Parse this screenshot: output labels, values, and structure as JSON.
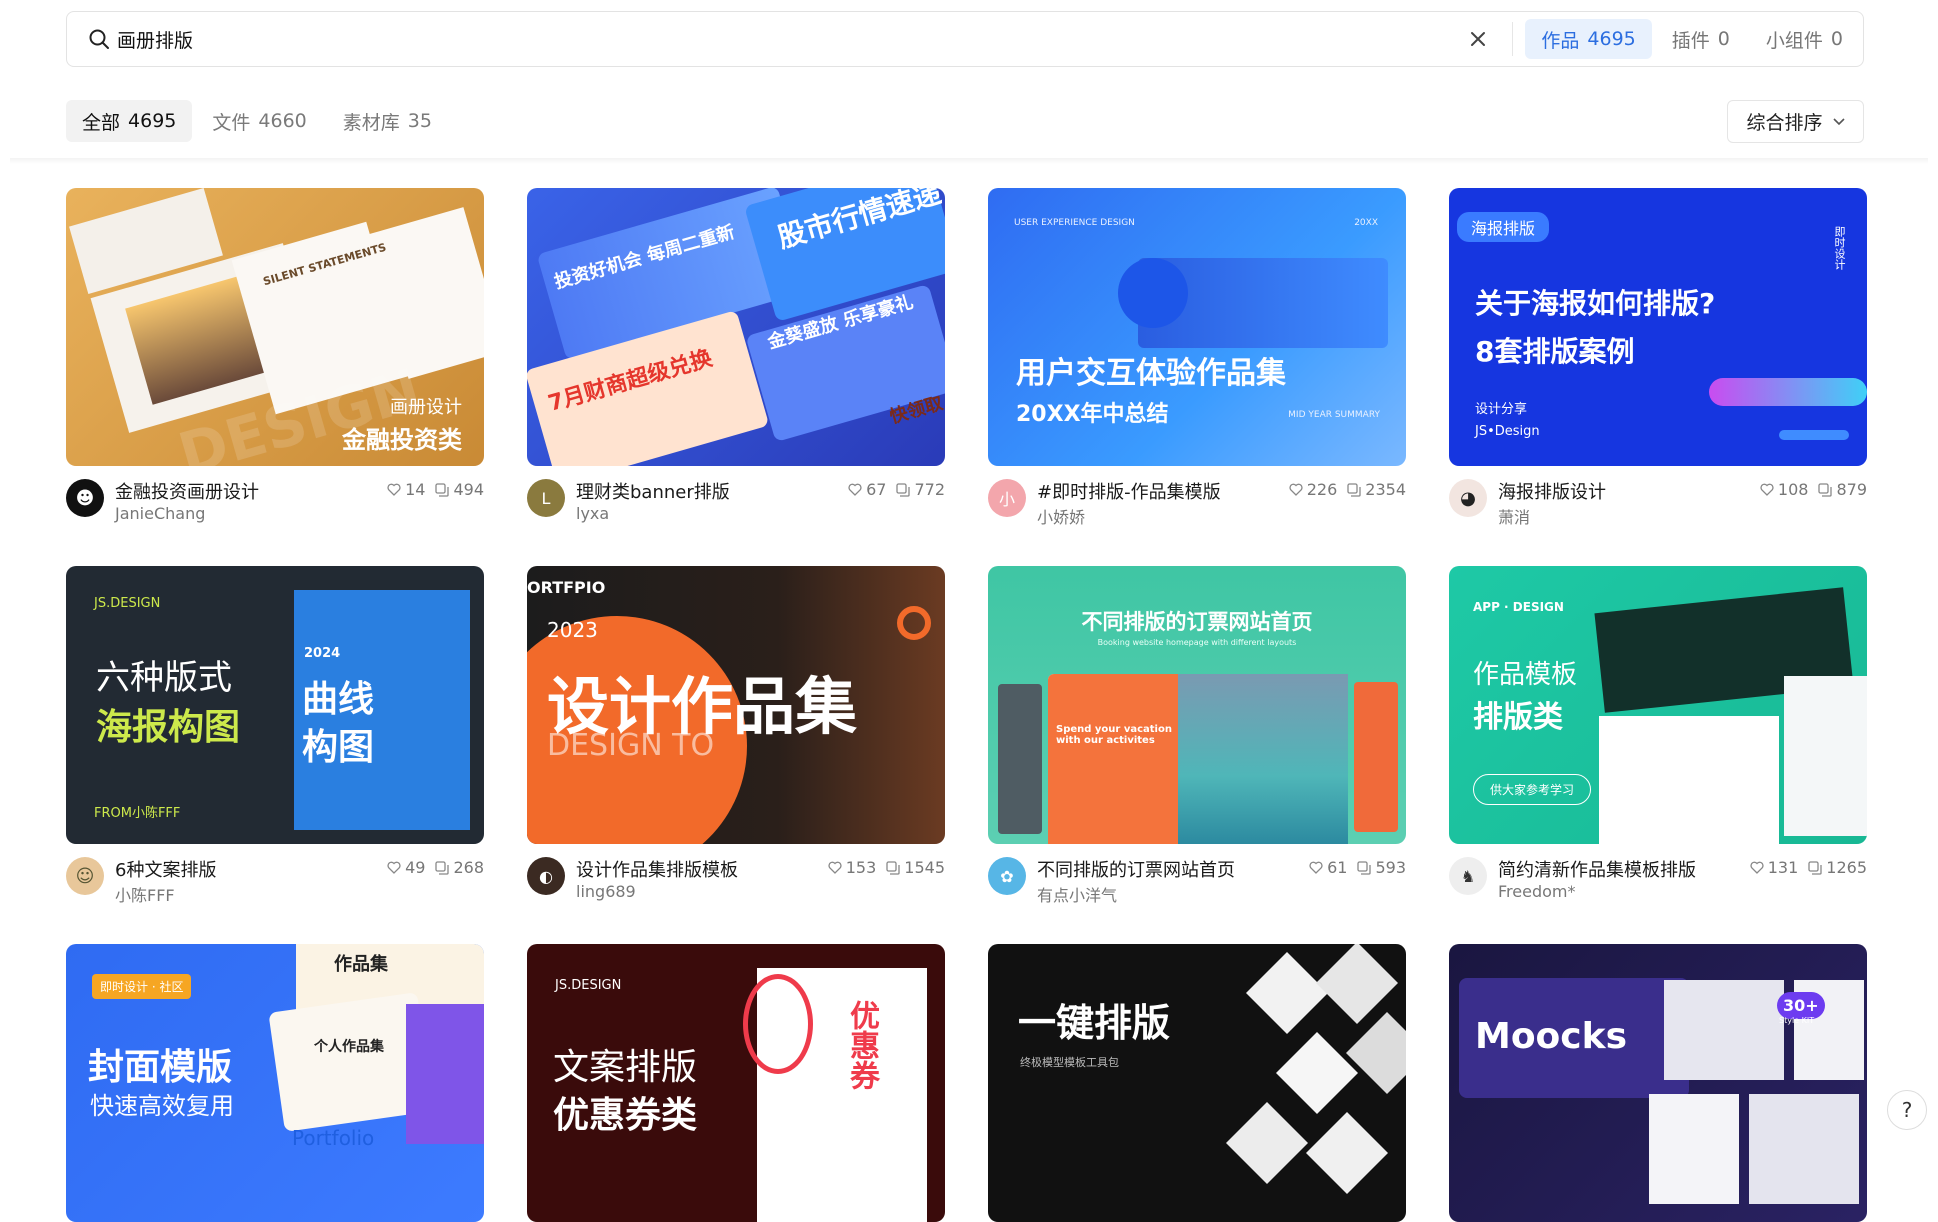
{
  "search": {
    "value": "画册排版"
  },
  "scopes": [
    {
      "label": "作品",
      "count": "4695"
    },
    {
      "label": "插件",
      "count": "0"
    },
    {
      "label": "小组件",
      "count": "0"
    }
  ],
  "filters": [
    {
      "label": "全部",
      "count": "4695"
    },
    {
      "label": "文件",
      "count": "4660"
    },
    {
      "label": "素材库",
      "count": "35"
    }
  ],
  "sort": {
    "label": "综合排序"
  },
  "colors": {
    "accent": "#2c6ee0",
    "accent_bg": "#e8f1fd"
  },
  "cards": [
    {
      "title": "金融投资画册设计",
      "author": "JanieChang",
      "likes": "14",
      "copies": "494",
      "thumb": {
        "lines": [
          "画册设计",
          "金融投资类",
          "SILENT STATEMENTS",
          "DESIGN"
        ]
      }
    },
    {
      "title": "理财类banner排版",
      "author": "lyxa",
      "likes": "67",
      "copies": "772",
      "avatar_letter": "L",
      "thumb": {
        "lines": [
          "投资好机会 每周二重新",
          "股市行情速递",
          "7月财商超级兑换",
          "金葵盛放 乐享豪礼",
          "快领取"
        ]
      }
    },
    {
      "title": "#即时排版-作品集模版",
      "author": "小娇娇",
      "likes": "226",
      "copies": "2354",
      "avatar_letter": "小",
      "thumb": {
        "lines": [
          "USER EXPERIENCE DESIGN",
          "20XX",
          "用户交互体验作品集",
          "20XX年中总结",
          "MID YEAR SUMMARY"
        ]
      }
    },
    {
      "title": "海报排版设计",
      "author": "萧消",
      "likes": "108",
      "copies": "879",
      "thumb": {
        "lines": [
          "海报排版",
          "关于海报如何排版?",
          "8套排版案例",
          "设计分享",
          "JS•Design",
          "即时设计"
        ]
      }
    },
    {
      "title": "6种文案排版",
      "author": "小陈FFF",
      "likes": "49",
      "copies": "268",
      "thumb": {
        "lines": [
          "JS.DESIGN",
          "六种版式",
          "海报构图",
          "FROM小陈FFF",
          "曲线构图",
          "2024"
        ]
      }
    },
    {
      "title": "设计作品集排版模板",
      "author": "ling689",
      "likes": "153",
      "copies": "1545",
      "thumb": {
        "lines": [
          "ORTFPIO",
          "2023",
          "设计作品集",
          "DESIGN TO"
        ]
      }
    },
    {
      "title": "不同排版的订票网站首页",
      "author": "有点小洋气",
      "likes": "61",
      "copies": "593",
      "thumb": {
        "lines": [
          "不同排版的订票网站首页",
          "Booking website homepage with different layouts",
          "Spend your vacation with our activites"
        ]
      }
    },
    {
      "title": "简约清新作品集模板排版",
      "author": "Freedom*",
      "likes": "131",
      "copies": "1265",
      "thumb": {
        "lines": [
          "APP · DESIGN",
          "作品模板",
          "排版类",
          "供大家参考学习"
        ]
      }
    },
    {
      "title": "",
      "author": "",
      "likes": "",
      "copies": "",
      "thumb": {
        "lines": [
          "即时设计 · 社区",
          "封面模版",
          "快速高效复用",
          "作品集",
          "个人作品集",
          "Portfolio"
        ]
      }
    },
    {
      "title": "",
      "author": "",
      "likes": "",
      "copies": "",
      "thumb": {
        "lines": [
          "JS.DESIGN",
          "文案排版",
          "优惠券类",
          "优惠券"
        ]
      }
    },
    {
      "title": "",
      "author": "",
      "likes": "",
      "copies": "",
      "thumb": {
        "lines": [
          "一键排版",
          "终极模型模板工具包"
        ]
      }
    },
    {
      "title": "",
      "author": "",
      "likes": "",
      "copies": "",
      "thumb": {
        "lines": [
          "Moocks",
          "30+",
          "Style KIT"
        ]
      }
    }
  ],
  "help": {
    "label": "?"
  }
}
